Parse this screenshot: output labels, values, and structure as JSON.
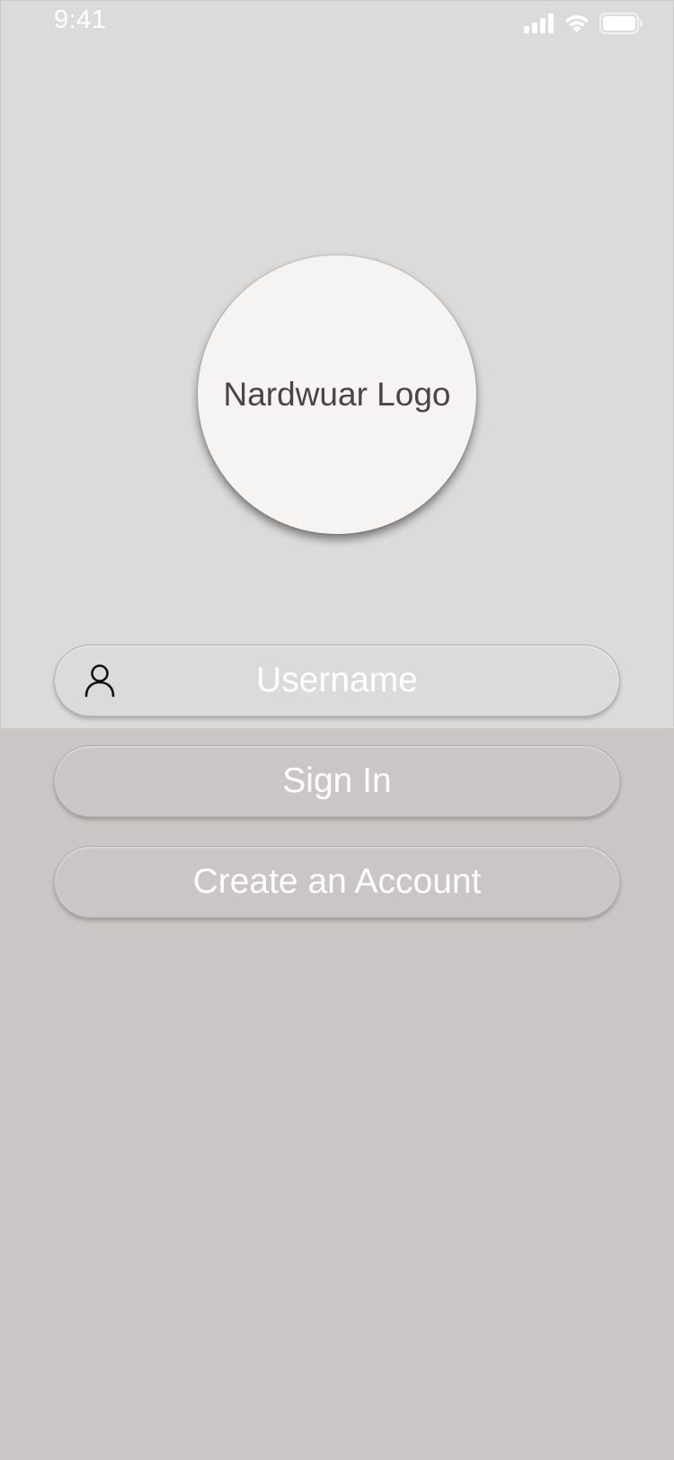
{
  "status_bar": {
    "time": "9:41",
    "icons": [
      "cellular-signal-icon",
      "wifi-icon",
      "battery-icon"
    ]
  },
  "logo": {
    "text": "Nardwuar Logo"
  },
  "login_form": {
    "username_placeholder": "Username",
    "username_icon": "user-icon",
    "sign_in_label": "Sign In",
    "create_account_label": "Create an Account"
  },
  "colors": {
    "top_background": "#dbdbdb",
    "bottom_background": "#cac6c5",
    "logo_circle": "#f6f4f3",
    "text_light": "#ffffff",
    "logo_text": "#4a4444"
  }
}
